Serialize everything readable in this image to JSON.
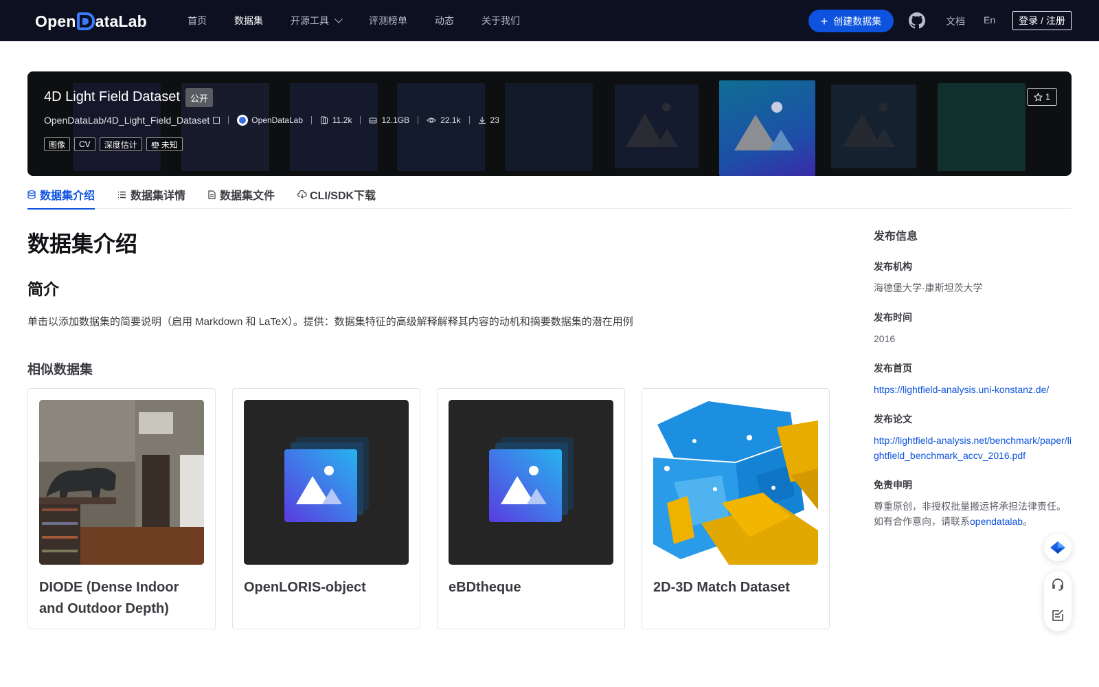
{
  "nav": {
    "logo_pre": "Open",
    "logo_post": "ataLab",
    "links": [
      "首页",
      "数据集",
      "开源工具",
      "评测榜单",
      "动态",
      "关于我们"
    ],
    "create_label": "创建数据集",
    "docs_label": "文档",
    "lang_label": "En",
    "login_label": "登录 / 注册"
  },
  "dataset": {
    "title": "4D Light Field Dataset",
    "visibility": "公开",
    "path": "OpenDataLab/4D_Light_Field_Dataset",
    "org": "OpenDataLab",
    "files": "11.2k",
    "size": "12.1GB",
    "views": "22.1k",
    "downloads": "23",
    "tags": [
      "图像",
      "CV",
      "深度估计"
    ],
    "license": "未知",
    "stars": "1"
  },
  "tabs": [
    "数据集介绍",
    "数据集详情",
    "数据集文件",
    "CLI/SDK下载"
  ],
  "main": {
    "heading": "数据集介绍",
    "intro_heading": "简介",
    "intro_text": "单击以添加数据集的简要说明（启用 Markdown 和 LaTeX）。提供：数据集特征的高级解释解释其内容的动机和摘要数据集的潜在用例",
    "similar_heading": "相似数据集",
    "similar": [
      {
        "title": "DIODE (Dense Indoor and Outdoor Depth)"
      },
      {
        "title": "OpenLORIS-object"
      },
      {
        "title": "eBDtheque"
      },
      {
        "title": "2D-3D Match Dataset"
      }
    ]
  },
  "sidebar": {
    "title": "发布信息",
    "org_label": "发布机构",
    "org_value": "海德堡大学·康斯坦茨大学",
    "time_label": "发布时间",
    "time_value": "2016",
    "home_label": "发布首页",
    "home_value": "https://lightfield-analysis.uni-konstanz.de/",
    "paper_label": "发布论文",
    "paper_value": "http://lightfield-analysis.net/benchmark/paper/lightfield_benchmark_accv_2016.pdf",
    "disclaimer_label": "免责申明",
    "disclaimer_line1": "尊重原创，非授权批量搬运将承担法律责任。",
    "disclaimer_line2_pre": "如有合作意向，请联系",
    "disclaimer_link": "opendatalab",
    "disclaimer_line2_post": "。"
  },
  "colors": {
    "nav_bg": "#0d1021",
    "accent": "#0d53de",
    "hero_bg": "#0e0f11"
  }
}
